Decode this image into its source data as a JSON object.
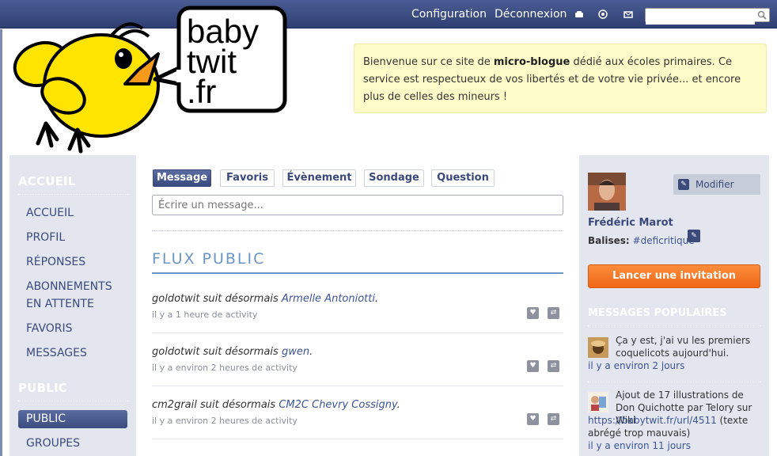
{
  "topbar": {
    "configuration": "Configuration",
    "deconnexion": "Déconnexion",
    "search_placeholder": ""
  },
  "logo": {
    "line1": "baby",
    "line2": "twit",
    "line3": ".fr"
  },
  "welcome": {
    "part1": "Bienvenue sur ce site de ",
    "bold": "micro-blogue",
    "part2": " dédié aux écoles primaires. Ce service est respectueux de vos libertés et de votre vie privée... et encore plus de celles des mineurs !"
  },
  "leftnav": {
    "section1": "ACCUEIL",
    "items1": [
      "ACCUEIL",
      "PROFIL",
      "RÉPONSES",
      "ABONNEMENTS EN ATTENTE",
      "FAVORIS",
      "MESSAGES"
    ],
    "section2": "PUBLIC",
    "items2": [
      "PUBLIC",
      "GROUPES"
    ]
  },
  "tabs": [
    "Message",
    "Favoris",
    "Évènement",
    "Sondage",
    "Question"
  ],
  "composer": {
    "placeholder": "Écrire un message..."
  },
  "feed": {
    "title": "FLUX PUBLIC",
    "entries": [
      {
        "user": "goldotwit",
        "verb": " suit désormais ",
        "target": "Armelle Antoniotti",
        "end": ".",
        "meta": "il y a 1 heure de activity"
      },
      {
        "user": "goldotwit",
        "verb": " suit désormais ",
        "target": "gwen",
        "end": ".",
        "meta": "il y a environ 2 heures de activity"
      },
      {
        "user": "cm2grail",
        "verb": " suit désormais ",
        "target": "CM2C Chevry Cossigny",
        "end": ".",
        "meta": "il y a environ 2 heures de activity"
      }
    ]
  },
  "profile": {
    "modify": "Modifier",
    "name": "Frédéric Marot",
    "tags_label": "Balises:",
    "tag": "#deficritique",
    "invite": "Lancer une invitation"
  },
  "popular": {
    "title": "MESSAGES POPULAIRES",
    "items": [
      {
        "text": "Ça y est, j'ai vu les premiers coquelicots aujourd'hui.",
        "url": "",
        "after": "",
        "when": "il y a environ 2 jours"
      },
      {
        "text": "Ajout de 17 illustrations de Don Quichotte par Telory sur Wiki",
        "url": "https://babytwit.fr/url/4511",
        "after": " (texte abrégé trop mauvais)",
        "when": "il y a environ 11 jours"
      }
    ]
  },
  "colors": {
    "topbar": "#3b4a7e",
    "accent_blue": "#6b94c8",
    "invite_orange": "#f47a28",
    "welcome_bg": "#fdfbc8",
    "sidebar_bg": "#e3e6ef"
  }
}
